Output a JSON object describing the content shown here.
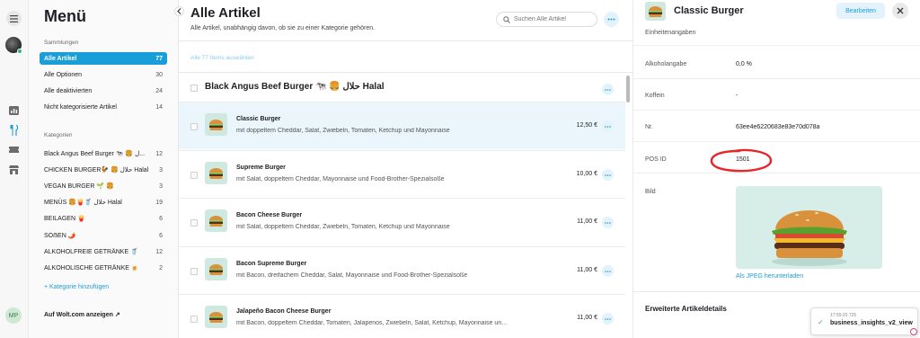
{
  "rail": {
    "avatar_initials": "MP"
  },
  "sidebar": {
    "title": "Menü",
    "collections_heading": "Sammlungen",
    "collections": [
      {
        "label": "Alle Artikel",
        "count": "77",
        "active": true
      },
      {
        "label": "Alle Optionen",
        "count": "30"
      },
      {
        "label": "Alle deaktivierten",
        "count": "24"
      },
      {
        "label": "Nicht kategorisierte Artikel",
        "count": "14"
      }
    ],
    "categories_heading": "Kategorien",
    "categories": [
      {
        "label": "Black Angus Beef Burger 🐄 🍔 ل...",
        "count": "12"
      },
      {
        "label": "CHICKEN BURGER🐓 🍔 حلال Halal",
        "count": "3"
      },
      {
        "label": "VEGAN BURGER 🌱 🍔",
        "count": "3"
      },
      {
        "label": "MENÜS 🍔🍟🥤 حلال Halal",
        "count": "19"
      },
      {
        "label": "BEILAGEN 🍟",
        "count": "6"
      },
      {
        "label": "SOẞEN 🌶️",
        "count": "6"
      },
      {
        "label": "ALKOHOLFREIE GETRÄNKE 🥤",
        "count": "12"
      },
      {
        "label": "ALKOHOLISCHE GETRÄNKE 🍺",
        "count": "2"
      }
    ],
    "add_category": "+ Kategorie hinzufügen",
    "wolt_link": "Auf Wolt.com anzeigen ↗"
  },
  "main": {
    "title": "Alle Artikel",
    "subtitle": "Alle Artikel, unabhängig davon, ob sie zu einer Kategorie gehören.",
    "search_placeholder": "Suchen Alle Artikel",
    "select_all": "Alle 77 Items auswählen",
    "category_name": "Black Angus Beef Burger 🐄 🍔 حلال Halal",
    "items": [
      {
        "name": "Classic Burger",
        "desc": "mit doppeltem Cheddar, Salat, Zwiebeln, Tomaten, Ketchup und Mayonnaise",
        "price": "12,50 €",
        "selected": true
      },
      {
        "name": "Supreme Burger",
        "desc": "mit Salat, doppeltem Cheddar, Mayonnaise und Food-Brother-Spezialsoße",
        "price": "10,00 €"
      },
      {
        "name": "Bacon Cheese Burger",
        "desc": "mit Salat, doppeltem Cheddar, Zwiebeln, Tomaten, Ketchup und Mayonnaise",
        "price": "11,00 €"
      },
      {
        "name": "Bacon Supreme Burger",
        "desc": "mit Bacon, dreifachem Cheddar, Salat, Mayonnaise und Food-Brother-Spezialsoße",
        "price": "11,00 €"
      },
      {
        "name": "Jalapeño Bacon Cheese Burger",
        "desc": "mit Bacon, doppeltem Cheddar, Tomaten, Jalapenos, Zwiebeln, Salat, Ketchup, Mayonnaise und Sweet-Chili-Soße",
        "price": "11,00 €"
      }
    ]
  },
  "detail": {
    "title": "Classic Burger",
    "edit_label": "Bearbeiten",
    "rows": [
      {
        "label": "Einheitenangaben",
        "value": ""
      },
      {
        "label": "Alkoholangabe",
        "value": "0,0 %"
      },
      {
        "label": "Koffein",
        "value": "-"
      },
      {
        "label": "Nr.",
        "value": "63ee4e6220683e83e70d078a"
      },
      {
        "label": "POS ID",
        "value": "1501"
      }
    ],
    "image_label": "Bild",
    "download_link": "Als JPEG herunterladen",
    "advanced": "Erweiterte Artikeldetails"
  },
  "toast": {
    "time": "17:59:20.725",
    "text": "business_insights_v2_view"
  },
  "colors": {
    "accent": "#199ed9",
    "selected_row": "#eaf6fc",
    "annotation": "#e8262a"
  }
}
